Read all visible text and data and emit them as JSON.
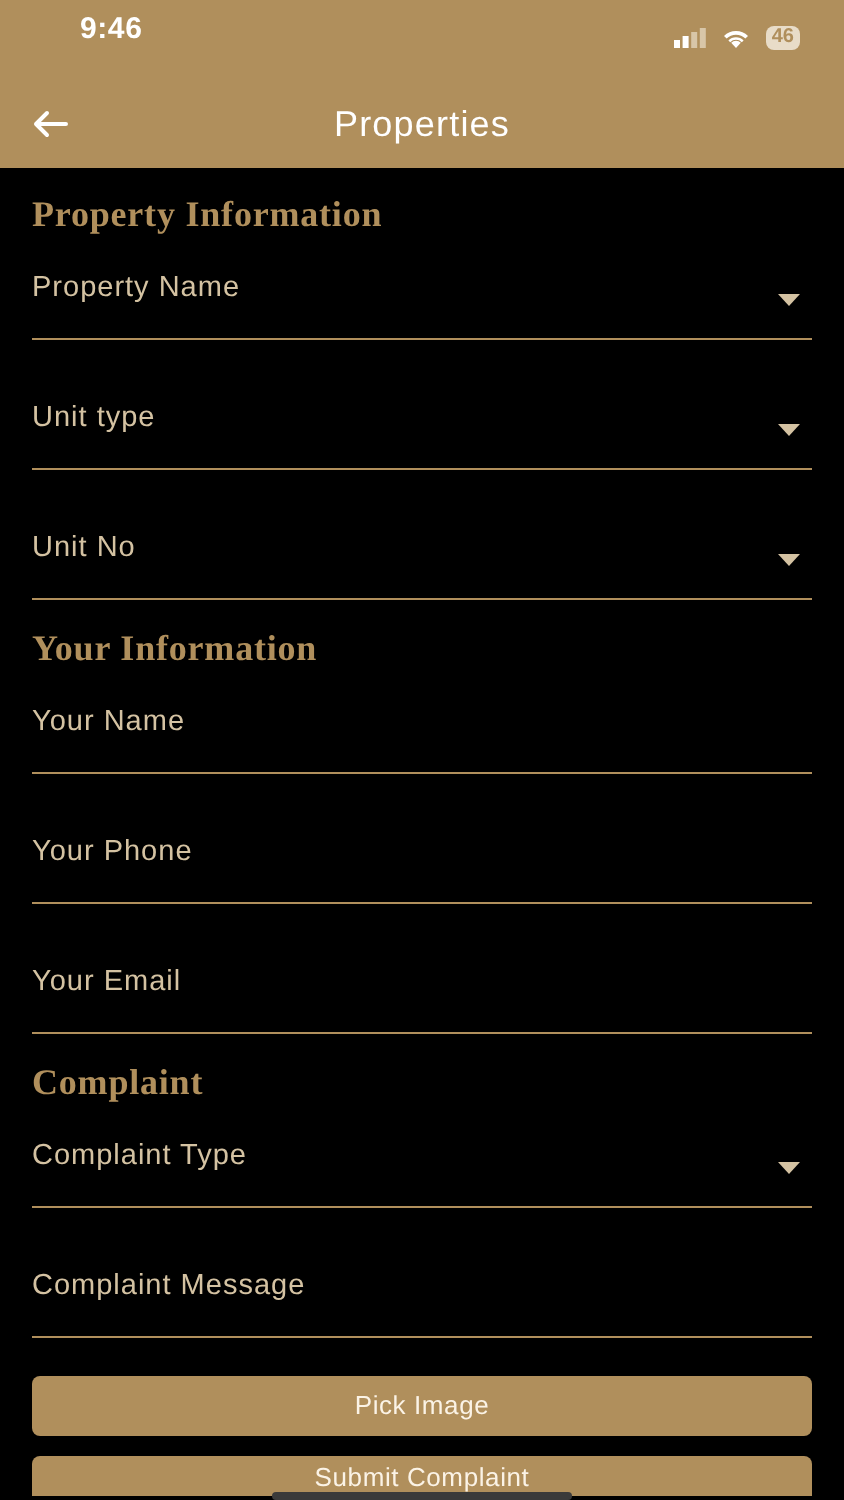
{
  "status_bar": {
    "time": "9:46",
    "battery": "46"
  },
  "app_bar": {
    "title": "Properties"
  },
  "sections": [
    {
      "heading": "Property Information",
      "fields": [
        {
          "label": "Property Name",
          "kind": "dropdown"
        },
        {
          "label": "Unit type",
          "kind": "dropdown"
        },
        {
          "label": "Unit No",
          "kind": "dropdown"
        }
      ]
    },
    {
      "heading": "Your Information",
      "fields": [
        {
          "label": "Your Name",
          "kind": "text"
        },
        {
          "label": "Your Phone",
          "kind": "text"
        },
        {
          "label": "Your Email",
          "kind": "text"
        }
      ]
    },
    {
      "heading": "Complaint",
      "fields": [
        {
          "label": "Complaint Type",
          "kind": "dropdown"
        },
        {
          "label": "Complaint Message",
          "kind": "text"
        }
      ]
    }
  ],
  "buttons": [
    "Pick Image",
    "Submit Complaint"
  ]
}
